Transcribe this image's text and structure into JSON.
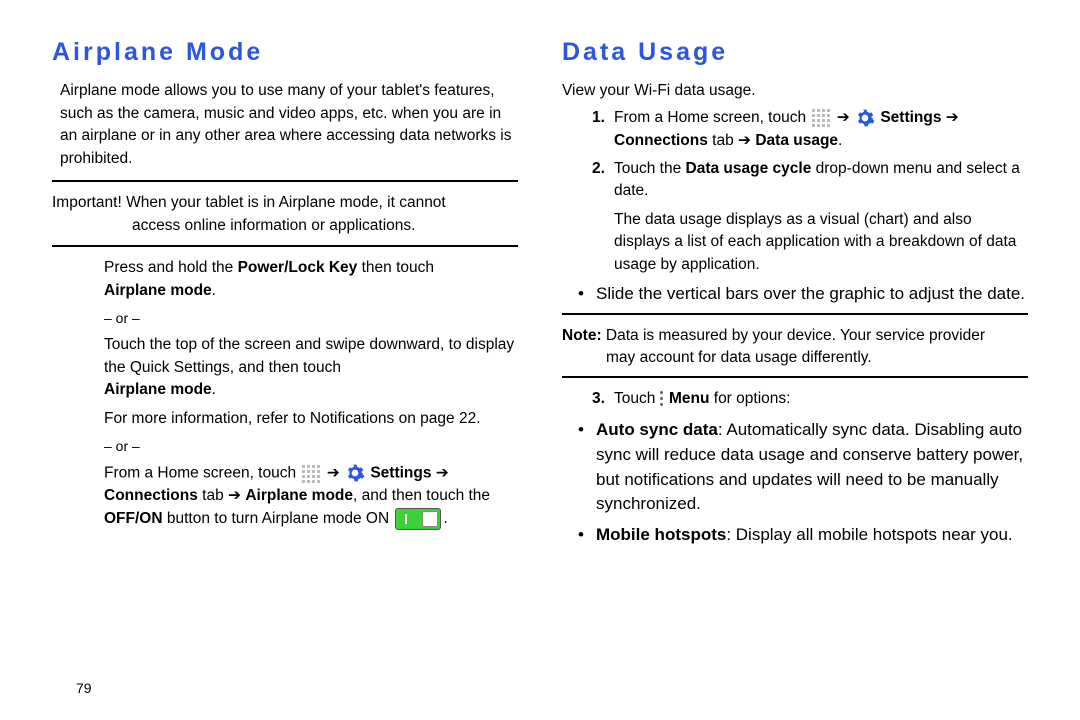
{
  "left": {
    "heading": "Airplane Mode",
    "intro": "Airplane mode allows you to use many of your tablet's features, such as the camera, music and video apps, etc. when you are in an airplane or in any other area where accessing data networks is prohibited.",
    "important_label": "Important!",
    "important_text1": " When your tablet is in Airplane mode, it cannot",
    "important_text2": "access online information or applications.",
    "step1a_pre": "Press and hold the ",
    "step1a_key": "Power/Lock Key",
    "step1a_post": " then touch ",
    "step1a_mode": "Airplane mode",
    "step1a_end": ".",
    "or": "– or –",
    "step1b": "Touch the top of the screen and swipe downward, to display the Quick Settings, and then touch ",
    "step1b_mode": "Airplane mode",
    "step1b_end": ".",
    "ref_pre": "For more information, refer to ",
    "ref_link": "Notifications",
    "ref_post": " on page 22.",
    "step1c_pre": "From a Home screen, touch ",
    "step1c_arrow": " ➔ ",
    "step1c_settings": "Settings",
    "step1c_arrow2": " ➔ ",
    "step1c_conn": "Connections",
    "step1c_tab": " tab ➔ ",
    "step1c_apm": "Airplane mode",
    "step1c_post": ", and then touch the ",
    "step1c_offon": "OFF/ON",
    "step1c_post2": " button to turn Airplane mode ON ",
    "step1c_end": "."
  },
  "right": {
    "heading": "Data Usage",
    "intro": "View your Wi-Fi data usage.",
    "s1_num": "1.",
    "s1_pre": "From a Home screen, touch ",
    "s1_arrow": " ➔ ",
    "s1_settings": "Settings",
    "s1_arrow2": " ➔ ",
    "s1_conn": "Connections",
    "s1_tab": " tab ➔ ",
    "s1_du": "Data usage",
    "s1_end": ".",
    "s2_num": "2.",
    "s2_pre": "Touch the ",
    "s2_cycle": "Data usage cycle",
    "s2_post": " drop-down menu and select a date.",
    "s2_expl": "The data usage displays as a visual (chart) and also displays a list of each application with a breakdown of data usage by application.",
    "s2_bullet": "Slide the vertical bars over the graphic to adjust the date.",
    "note_label": "Note:",
    "note_text1": " Data is measured by your device. Your service provider",
    "note_text2": "may account for data usage differently.",
    "s3_num": "3.",
    "s3_pre": "Touch ",
    "s3_menu": "Menu",
    "s3_post": " for options:",
    "opt1_name": "Auto sync data",
    "opt1_text": ": Automatically sync data. Disabling auto sync will reduce data usage and conserve battery power, but notifications and updates will need to be manually synchronized.",
    "opt2_name": "Mobile hotspots",
    "opt2_text": ": Display all mobile hotspots near you."
  },
  "page_num": "79"
}
